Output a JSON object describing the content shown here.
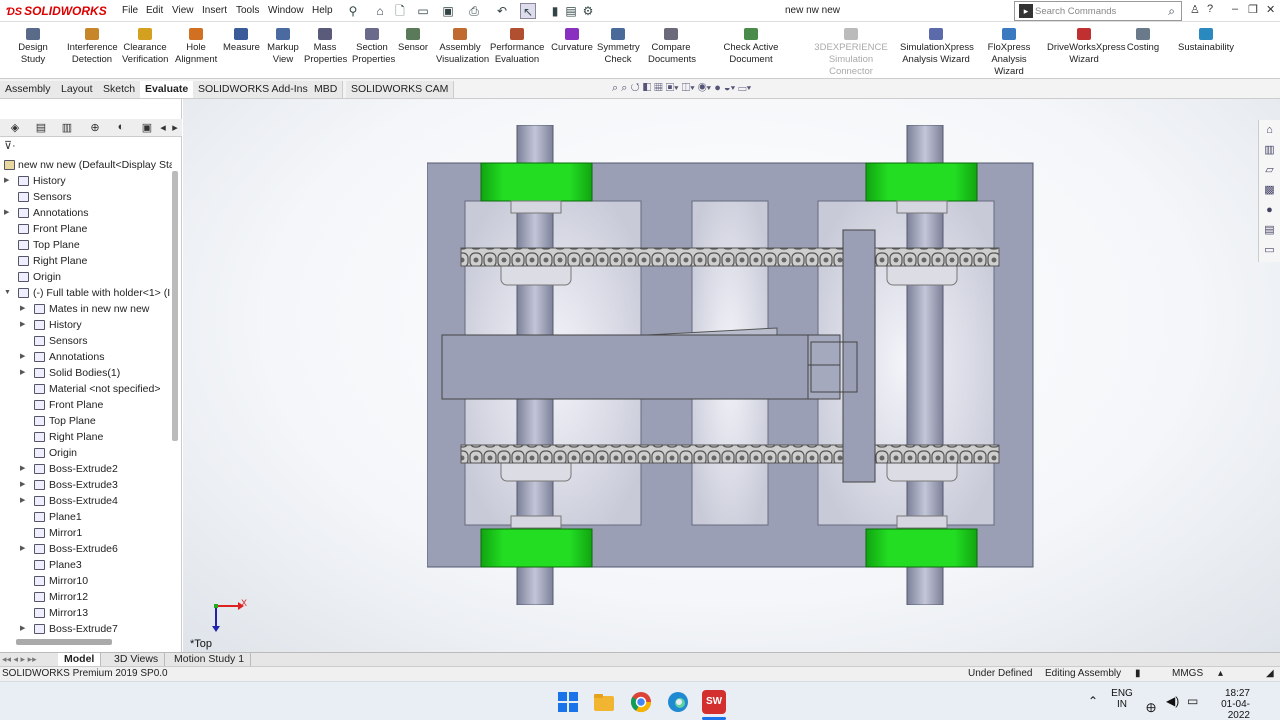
{
  "app": {
    "logo": "SOLIDWORKS",
    "document_title": "new nw new",
    "menu": [
      "File",
      "Edit",
      "View",
      "Insert",
      "Tools",
      "Window",
      "Help"
    ],
    "search_placeholder": "Search Commands",
    "help_label": "?"
  },
  "ribbon": {
    "tools": [
      {
        "label1": "Design Study",
        "label2": "",
        "icon": "design-study-icon",
        "color": "#5a6b8a"
      },
      {
        "label1": "Interference",
        "label2": "Detection",
        "icon": "interference-icon",
        "color": "#c8862a"
      },
      {
        "label1": "Clearance",
        "label2": "Verification",
        "icon": "clearance-icon",
        "color": "#d4a020"
      },
      {
        "label1": "Hole",
        "label2": "Alignment",
        "icon": "hole-alignment-icon",
        "color": "#d07020"
      },
      {
        "label1": "Measure",
        "label2": "",
        "icon": "measure-icon",
        "color": "#3a5a9a"
      },
      {
        "label1": "Markup",
        "label2": "View",
        "icon": "markup-icon",
        "color": "#4a6aa0"
      },
      {
        "label1": "Mass",
        "label2": "Properties",
        "icon": "mass-properties-icon",
        "color": "#5a5a7a"
      },
      {
        "label1": "Section",
        "label2": "Properties",
        "icon": "section-properties-icon",
        "color": "#6a6a8a"
      },
      {
        "label1": "Sensor",
        "label2": "",
        "icon": "sensor-icon",
        "color": "#5a7a5a"
      },
      {
        "label1": "Assembly",
        "label2": "Visualization",
        "icon": "assembly-visualization-icon",
        "color": "#c06a30"
      },
      {
        "label1": "Performance",
        "label2": "Evaluation",
        "icon": "performance-icon",
        "color": "#b05030"
      },
      {
        "label1": "Curvature",
        "label2": "",
        "icon": "curvature-icon",
        "color": "#8a30c0"
      },
      {
        "label1": "Symmetry",
        "label2": "Check",
        "icon": "symmetry-icon",
        "color": "#4a6a9a"
      },
      {
        "label1": "Compare",
        "label2": "Documents",
        "icon": "compare-icon",
        "color": "#6a6a7a"
      },
      {
        "label1": "Check Active Document",
        "label2": "",
        "icon": "check-document-icon",
        "color": "#4a8a4a"
      },
      {
        "label1": "3DEXPERIENCE",
        "label2": "Simulation Connector",
        "icon": "3dx-icon",
        "color": "#bbbbbb"
      },
      {
        "label1": "SimulationXpress",
        "label2": "Analysis Wizard",
        "icon": "simulationxpress-icon",
        "color": "#5a6aaa"
      },
      {
        "label1": "FloXpress",
        "label2": "Analysis Wizard",
        "icon": "floxpress-icon",
        "color": "#3a7ac0"
      },
      {
        "label1": "DriveWorksXpress",
        "label2": "Wizard",
        "icon": "driveworks-icon",
        "color": "#c03030"
      },
      {
        "label1": "Costing",
        "label2": "",
        "icon": "costing-icon",
        "color": "#6a7a8a"
      },
      {
        "label1": "Sustainability",
        "label2": "",
        "icon": "sustainability-icon",
        "color": "#2a8ac0"
      }
    ]
  },
  "command_tabs": [
    "Assembly",
    "Layout",
    "Sketch",
    "Evaluate",
    "SOLIDWORKS Add-Ins",
    "MBD",
    "SOLIDWORKS CAM"
  ],
  "active_command_tab": "Evaluate",
  "tree": {
    "root": "new nw new  (Default<Display Sta",
    "items": [
      {
        "label": "History",
        "icon": "history-icon",
        "expandable": true,
        "level": 0
      },
      {
        "label": "Sensors",
        "icon": "sensors-icon",
        "expandable": false,
        "level": 0
      },
      {
        "label": "Annotations",
        "icon": "annotations-icon",
        "expandable": true,
        "level": 0
      },
      {
        "label": "Front Plane",
        "icon": "plane-icon",
        "expandable": false,
        "level": 0
      },
      {
        "label": "Top Plane",
        "icon": "plane-icon",
        "expandable": false,
        "level": 0
      },
      {
        "label": "Right Plane",
        "icon": "plane-icon",
        "expandable": false,
        "level": 0
      },
      {
        "label": "Origin",
        "icon": "origin-icon",
        "expandable": false,
        "level": 0
      },
      {
        "label": "(-) Full table with holder<1> (I",
        "icon": "part-icon",
        "expandable": true,
        "expanded": true,
        "level": 0
      },
      {
        "label": "Mates in new nw new",
        "icon": "mates-icon",
        "expandable": true,
        "level": 1
      },
      {
        "label": "History",
        "icon": "history-icon",
        "expandable": true,
        "level": 1
      },
      {
        "label": "Sensors",
        "icon": "sensors-icon",
        "expandable": false,
        "level": 1
      },
      {
        "label": "Annotations",
        "icon": "annotations-icon",
        "expandable": true,
        "level": 1
      },
      {
        "label": "Solid Bodies(1)",
        "icon": "solid-bodies-icon",
        "expandable": true,
        "level": 1
      },
      {
        "label": "Material <not specified>",
        "icon": "material-icon",
        "expandable": false,
        "level": 1
      },
      {
        "label": "Front Plane",
        "icon": "plane-icon",
        "expandable": false,
        "level": 1
      },
      {
        "label": "Top Plane",
        "icon": "plane-icon",
        "expandable": false,
        "level": 1
      },
      {
        "label": "Right Plane",
        "icon": "plane-icon",
        "expandable": false,
        "level": 1
      },
      {
        "label": "Origin",
        "icon": "origin-icon",
        "expandable": false,
        "level": 1
      },
      {
        "label": "Boss-Extrude2",
        "icon": "extrude-icon",
        "expandable": true,
        "level": 1
      },
      {
        "label": "Boss-Extrude3",
        "icon": "extrude-icon",
        "expandable": true,
        "level": 1
      },
      {
        "label": "Boss-Extrude4",
        "icon": "extrude-icon",
        "expandable": true,
        "level": 1
      },
      {
        "label": "Plane1",
        "icon": "plane-icon",
        "expandable": false,
        "level": 1
      },
      {
        "label": "Mirror1",
        "icon": "mirror-icon",
        "expandable": false,
        "level": 1
      },
      {
        "label": "Boss-Extrude6",
        "icon": "extrude-icon",
        "expandable": true,
        "level": 1
      },
      {
        "label": "Plane3",
        "icon": "plane-icon",
        "expandable": false,
        "level": 1
      },
      {
        "label": "Mirror10",
        "icon": "mirror-icon",
        "expandable": false,
        "level": 1
      },
      {
        "label": "Mirror12",
        "icon": "mirror-icon",
        "expandable": false,
        "level": 1
      },
      {
        "label": "Mirror13",
        "icon": "mirror-icon",
        "expandable": false,
        "level": 1
      },
      {
        "label": "Boss-Extrude7",
        "icon": "extrude-icon",
        "expandable": true,
        "level": 1
      }
    ]
  },
  "viewport": {
    "view_label": "*Top",
    "triad_x": "X",
    "colors": {
      "body": "#9a9fb5",
      "bearing_green": "#22dd22",
      "shaft": "#a0a4bd",
      "chain": "#8a8a8a"
    }
  },
  "bottom_tabs": [
    "Model",
    "3D Views",
    "Motion Study 1"
  ],
  "active_bottom_tab": "Model",
  "status": {
    "product": "SOLIDWORKS Premium 2019 SP0.0",
    "state": "Under Defined",
    "mode": "Editing Assembly",
    "units": "MMGS"
  },
  "taskbar": {
    "lang1": "ENG",
    "lang2": "IN",
    "time": "18:27",
    "date": "01-04-2022",
    "sw_badge": "SW"
  }
}
